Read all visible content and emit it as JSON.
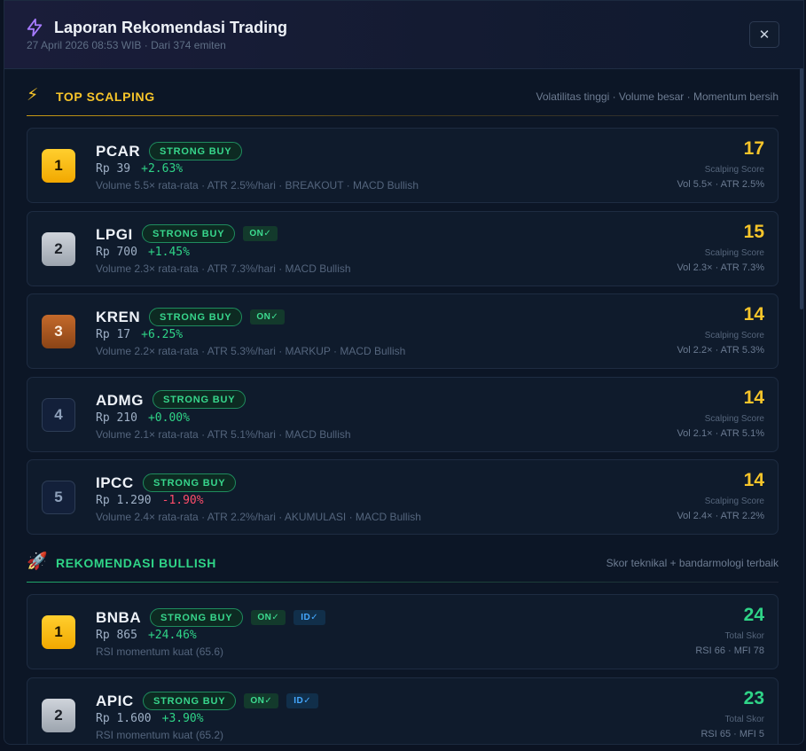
{
  "header": {
    "title": "Laporan Rekomendasi Trading",
    "subtitle": "27 April 2026 08:53 WIB · Dari 374 emiten",
    "close_label": "✕"
  },
  "scalping": {
    "title": "TOP SCALPING",
    "description": "Volatilitas tinggi · Volume besar · Momentum bersih",
    "score_label": "Scalping Score",
    "items": [
      {
        "rank": "1",
        "ticker": "PCAR",
        "badge": "STRONG BUY",
        "on": "",
        "price": "Rp 39",
        "change": "+2.63%",
        "desc": "Volume 5.5× rata-rata · ATR 2.5%/hari · BREAKOUT · MACD Bullish",
        "score": "17",
        "meta": "Vol 5.5× · ATR 2.5%"
      },
      {
        "rank": "2",
        "ticker": "LPGI",
        "badge": "STRONG BUY",
        "on": "ON✓",
        "price": "Rp 700",
        "change": "+1.45%",
        "desc": "Volume 2.3× rata-rata · ATR 7.3%/hari · MACD Bullish",
        "score": "15",
        "meta": "Vol 2.3× · ATR 7.3%"
      },
      {
        "rank": "3",
        "ticker": "KREN",
        "badge": "STRONG BUY",
        "on": "ON✓",
        "price": "Rp 17",
        "change": "+6.25%",
        "desc": "Volume 2.2× rata-rata · ATR 5.3%/hari · MARKUP · MACD Bullish",
        "score": "14",
        "meta": "Vol 2.2× · ATR 5.3%"
      },
      {
        "rank": "4",
        "ticker": "ADMG",
        "badge": "STRONG BUY",
        "on": "",
        "price": "Rp 210",
        "change": "+0.00%",
        "desc": "Volume 2.1× rata-rata · ATR 5.1%/hari · MACD Bullish",
        "score": "14",
        "meta": "Vol 2.1× · ATR 5.1%"
      },
      {
        "rank": "5",
        "ticker": "IPCC",
        "badge": "STRONG BUY",
        "on": "",
        "price": "Rp 1.290",
        "change": "-1.90%",
        "desc": "Volume 2.4× rata-rata · ATR 2.2%/hari · AKUMULASI · MACD Bullish",
        "score": "14",
        "meta": "Vol 2.4× · ATR 2.2%"
      }
    ]
  },
  "bullish": {
    "title": "REKOMENDASI BULLISH",
    "description": "Skor teknikal + bandarmologi terbaik",
    "score_label": "Total Skor",
    "items": [
      {
        "rank": "1",
        "ticker": "BNBA",
        "badge": "STRONG BUY",
        "on": "ON✓",
        "id": "ID✓",
        "price": "Rp 865",
        "change": "+24.46%",
        "desc": "RSI momentum kuat (65.6)",
        "score": "24",
        "meta": "RSI 66 · MFI 78"
      },
      {
        "rank": "2",
        "ticker": "APIC",
        "badge": "STRONG BUY",
        "on": "ON✓",
        "id": "ID✓",
        "price": "Rp 1.600",
        "change": "+3.90%",
        "desc": "RSI momentum kuat (65.2)",
        "score": "23",
        "meta": "RSI 65 · MFI 5"
      }
    ]
  },
  "colors": {
    "accent_yellow": "#f7c52a",
    "accent_green": "#2fd487",
    "negative_red": "#ff4d6a",
    "background": "#0c1626"
  },
  "icons": {
    "header": "lightning-bolt-icon",
    "scalping": "high-voltage-icon",
    "bullish": "rocket-icon",
    "close": "close-icon"
  }
}
